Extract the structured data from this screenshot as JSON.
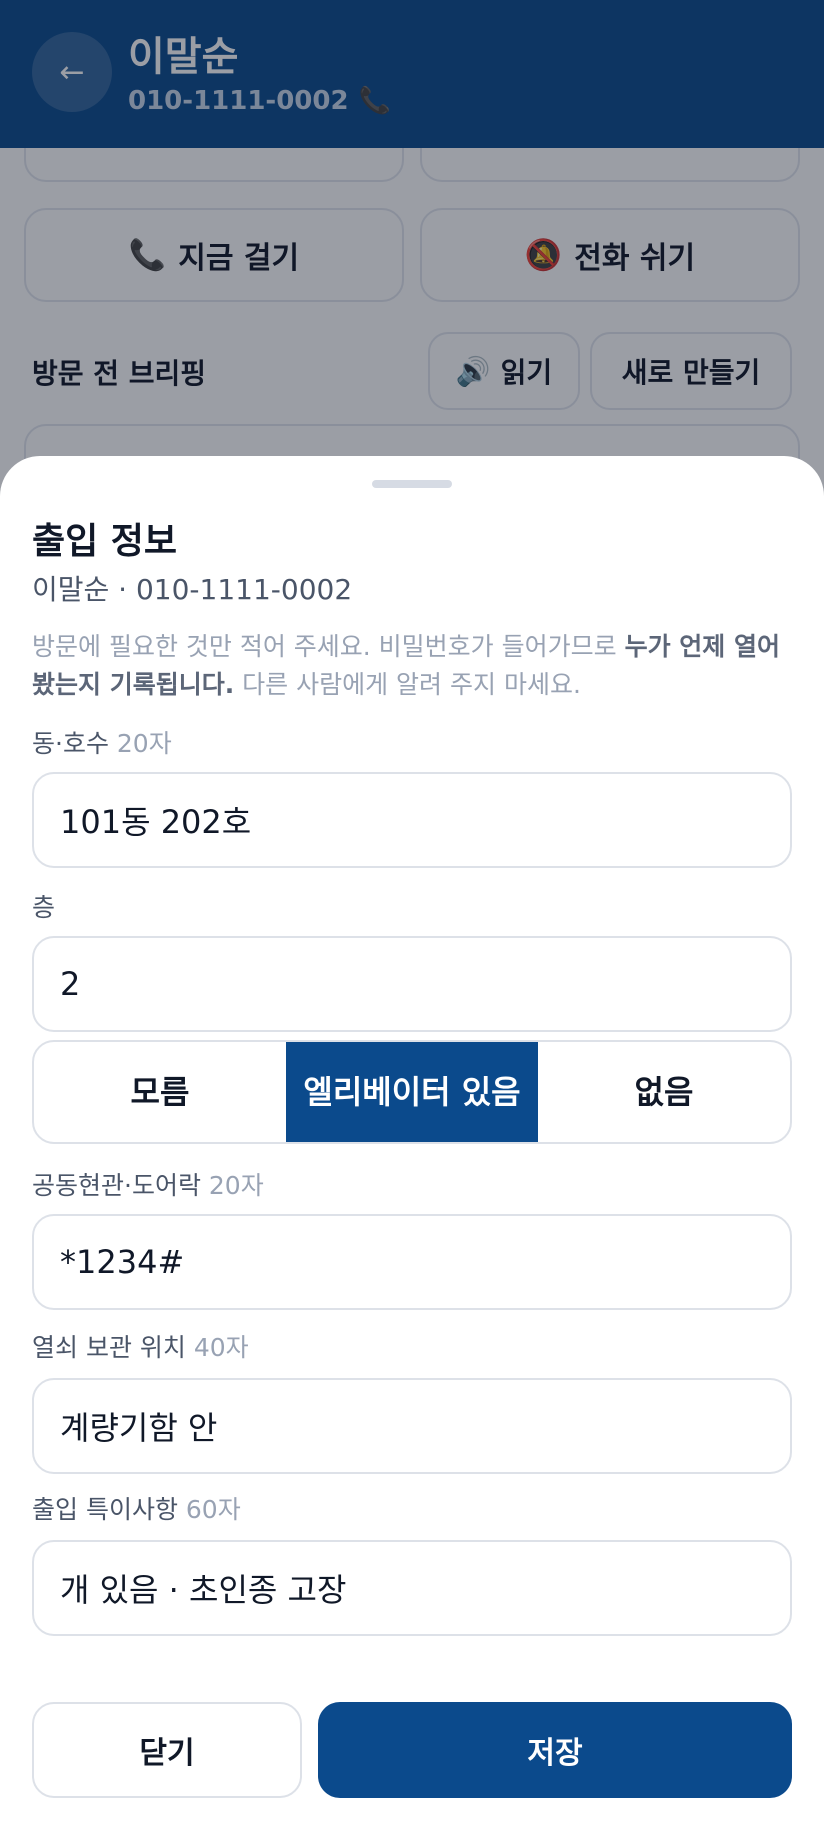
{
  "header": {
    "back_icon": "←",
    "name": "이말순",
    "phone": "010-1111-0002",
    "phone_icon": "📞"
  },
  "background": {
    "call_now_label": "지금 걸기",
    "call_now_icon": "📞",
    "pause_calls_label": "전화 쉬기",
    "pause_calls_icon": "🔕",
    "briefing_label": "방문 전 브리핑",
    "read_label": "읽기",
    "read_icon": "🔊",
    "new_label": "새로 만들기"
  },
  "sheet": {
    "title": "출입 정보",
    "subtitle": "이말순 · 010-1111-0002",
    "notice_pre": "방문에 필요한 것만 적어 주세요. 비밀번호가 들어가므로 ",
    "notice_bold": "누가 언제 열어 봤는지 기록됩니다.",
    "notice_post": " 다른 사람에게 알려 주지 마세요.",
    "fields": {
      "unit": {
        "label": "동·호수",
        "limit": "20자",
        "value": "101동 202호"
      },
      "floor": {
        "label": "층",
        "value": "2"
      },
      "entrance": {
        "label": "공동현관·도어락",
        "limit": "20자",
        "value": "*1234#"
      },
      "key": {
        "label": "열쇠 보관 위치",
        "limit": "40자",
        "value": "계량기함 안"
      },
      "notes": {
        "label": "출입 특이사항",
        "limit": "60자",
        "value": "개 있음 · 초인종 고장"
      }
    },
    "elevator": {
      "options": [
        "모름",
        "엘리베이터 있음",
        "없음"
      ],
      "selected": "엘리베이터 있음"
    },
    "close_label": "닫기",
    "save_label": "저장"
  },
  "colors": {
    "primary": "#0b4a8c",
    "border": "#dde1e8",
    "muted_text": "#98a2b3"
  }
}
